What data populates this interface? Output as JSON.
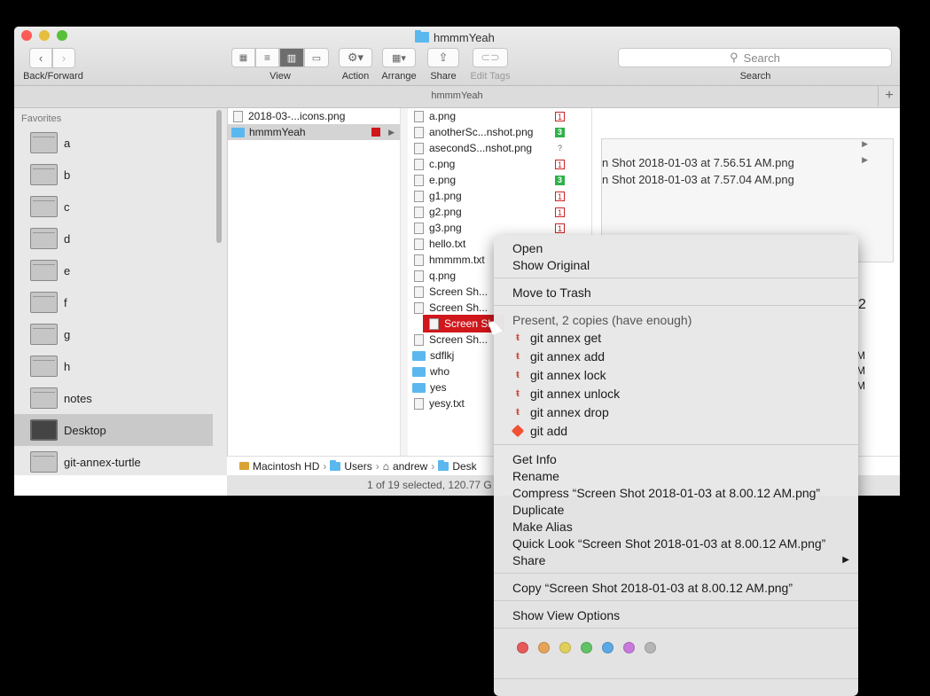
{
  "window": {
    "title": "hmmmYeah",
    "path_title": "hmmmYeah"
  },
  "toolbar": {
    "back_forward_label": "Back/Forward",
    "view_label": "View",
    "action_label": "Action",
    "arrange_label": "Arrange",
    "share_label": "Share",
    "edit_tags_label": "Edit Tags",
    "search_placeholder": "Search",
    "search_label": "Search"
  },
  "sidebar": {
    "heading": "Favorites",
    "items": [
      {
        "label": "a"
      },
      {
        "label": "b"
      },
      {
        "label": "c"
      },
      {
        "label": "d"
      },
      {
        "label": "e"
      },
      {
        "label": "f"
      },
      {
        "label": "g"
      },
      {
        "label": "h"
      },
      {
        "label": "notes"
      },
      {
        "label": "Desktop"
      },
      {
        "label": "git-annex-turtle"
      }
    ]
  },
  "column1": {
    "items": [
      {
        "label": "2018-03-...icons.png",
        "type": "file"
      },
      {
        "label": "hmmmYeah",
        "type": "folder"
      }
    ]
  },
  "column2": {
    "items": [
      {
        "label": "a.png",
        "badge": "1"
      },
      {
        "label": "anotherSc...nshot.png",
        "badge": "3"
      },
      {
        "label": "asecondS...nshot.png",
        "badge": "?"
      },
      {
        "label": "c.png",
        "badge": "1"
      },
      {
        "label": "e.png",
        "badge": "3"
      },
      {
        "label": "g1.png",
        "badge": "1"
      },
      {
        "label": "g2.png",
        "badge": "1"
      },
      {
        "label": "g3.png",
        "badge": "1"
      },
      {
        "label": "hello.txt",
        "badge": ""
      },
      {
        "label": "hmmmm.txt",
        "badge": ""
      },
      {
        "label": "q.png",
        "badge": ""
      },
      {
        "label": "Screen Sh...",
        "badge": ""
      },
      {
        "label": "Screen Sh...",
        "badge": ""
      },
      {
        "label": "Screen Sh...",
        "badge": ""
      },
      {
        "label": "Screen Sh...",
        "badge": ""
      },
      {
        "label": "sdflkj",
        "badge": ""
      },
      {
        "label": "who",
        "badge": ""
      },
      {
        "label": "yes",
        "badge": ""
      },
      {
        "label": "yesy.txt",
        "badge": ""
      }
    ]
  },
  "preview": {
    "line1": "n Shot 2018-01-03 at 7.56.51 AM.png",
    "line2": "n Shot 2018-01-03 at 7.57.04 AM.png",
    "frag1": "2",
    "frag2": "M",
    "frag3": "M",
    "frag4": "M"
  },
  "breadcrumbs": [
    "Macintosh HD",
    "Users",
    "andrew",
    "Desk"
  ],
  "status": "1 of 19 selected, 120.77 G",
  "context_menu": {
    "open": "Open",
    "show_original": "Show Original",
    "move_to_trash": "Move to Trash",
    "present": "Present, 2 copies (have enough)",
    "annex_get": "git annex get",
    "annex_add": "git annex add",
    "annex_lock": "git annex lock",
    "annex_unlock": "git annex unlock",
    "annex_drop": "git annex drop",
    "git_add": "git add",
    "get_info": "Get Info",
    "rename": "Rename",
    "compress": "Compress “Screen Shot 2018-01-03 at 8.00.12 AM.png”",
    "duplicate": "Duplicate",
    "make_alias": "Make Alias",
    "quick_look": "Quick Look “Screen Shot 2018-01-03 at 8.00.12 AM.png”",
    "share": "Share",
    "copy": "Copy “Screen Shot 2018-01-03 at 8.00.12 AM.png”",
    "show_view_options": "Show View Options",
    "tag_colors": [
      "#e55a5a",
      "#e5a35a",
      "#e0cf5a",
      "#62c266",
      "#5aa9e5",
      "#c77ad9",
      "#b5b5b5"
    ]
  }
}
